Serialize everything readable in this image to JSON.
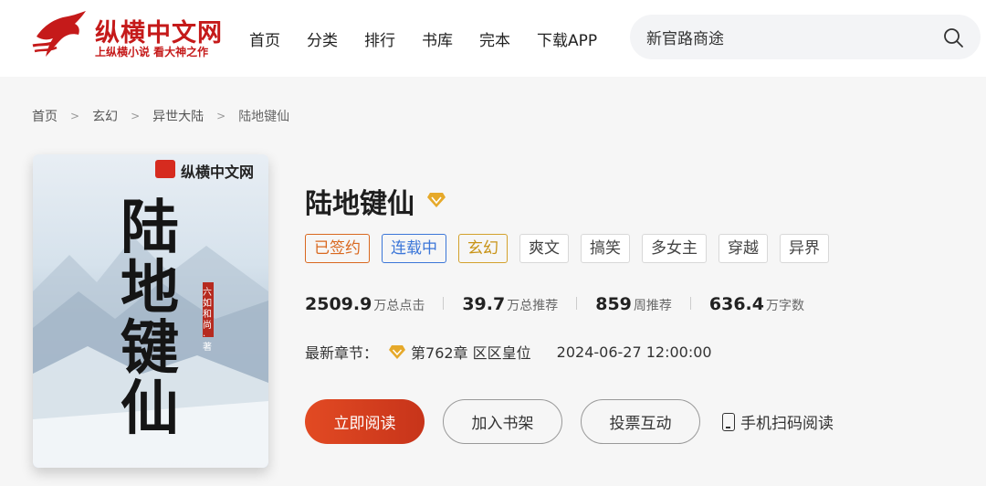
{
  "header": {
    "logo_name": "纵横中文网",
    "logo_slogan": "上纵横小说  看大神之作",
    "nav": [
      "首页",
      "分类",
      "排行",
      "书库",
      "完本",
      "下载APP"
    ],
    "search": {
      "value": "新官路商途",
      "icon": "search-icon"
    }
  },
  "breadcrumb": [
    "首页",
    "玄幻",
    "异世大陆",
    "陆地键仙"
  ],
  "cover": {
    "brand": "纵横中文网",
    "title_chars": [
      "陆",
      "地",
      "键",
      "仙"
    ],
    "author": "六如和尚·著"
  },
  "book": {
    "title": "陆地键仙",
    "tags": [
      "已签约",
      "连载中",
      "玄幻",
      "爽文",
      "搞笑",
      "多女主",
      "穿越",
      "异界"
    ],
    "stats": [
      {
        "num": "2509.9",
        "unit": "万总点击"
      },
      {
        "num": "39.7",
        "unit": "万总推荐"
      },
      {
        "num": "859",
        "unit": "周推荐"
      },
      {
        "num": "636.4",
        "unit": "万字数"
      }
    ],
    "latest_label": "最新章节：",
    "latest_chapter": "第762章 区区皇位",
    "latest_time": "2024-06-27 12:00:00"
  },
  "actions": {
    "read": "立即阅读",
    "shelf": "加入书架",
    "vote": "投票互动",
    "mobile": "手机扫码阅读"
  },
  "colors": {
    "brand_red": "#c51a1a",
    "read_button": "#d63d1f",
    "tag_signed": "#d9681f",
    "tag_serial": "#3b76d8",
    "tag_genre": "#c89316"
  }
}
